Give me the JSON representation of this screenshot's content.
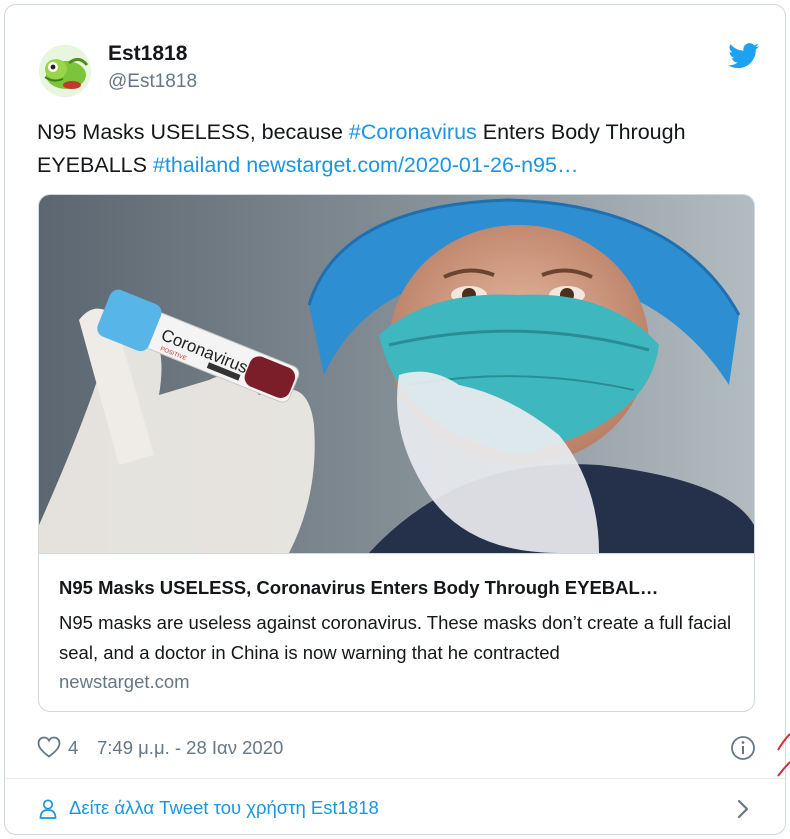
{
  "user": {
    "display_name": "Est1818",
    "handle": "@Est1818"
  },
  "tweet": {
    "text_part1": "N95 Masks USELESS, because ",
    "hashtag1": "#Coronavirus",
    "text_part2": " Enters Body Through EYEBALLS ",
    "hashtag2": "#thailand",
    "link": "newstarget.com/2020-01-26-n95…"
  },
  "link_card": {
    "image_vial_label": "Coronavirus",
    "image_vial_sublabel": "POSITIVE",
    "title": "N95 Masks USELESS, Coronavirus Enters Body Through EYEBAL…",
    "description": "N95 masks are useless against coronavirus. These masks don’t create a full facial seal, and a doctor in China is now warning that he contracted",
    "domain": "newstarget.com"
  },
  "meta": {
    "like_count": "4",
    "timestamp": "7:49 μ.μ. - 28 Ιαν 2020"
  },
  "footer": {
    "more_tweets_label": "Δείτε άλλα Tweet του χρήστη Est1818"
  },
  "colors": {
    "accent": "#1b95e0",
    "secondary_text": "#657786",
    "border": "#cfd9de"
  },
  "icons": [
    "twitter-bird-icon",
    "heart-icon",
    "info-icon",
    "user-icon",
    "chevron-right-icon"
  ]
}
